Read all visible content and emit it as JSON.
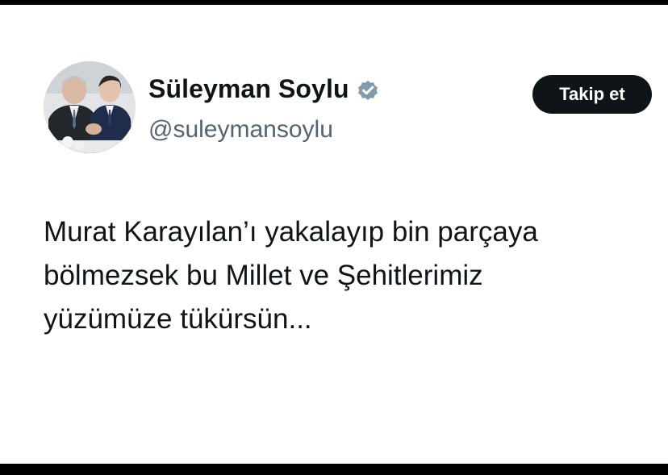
{
  "tweet": {
    "author": {
      "display_name": "Süleyman Soylu",
      "handle": "@suleymansoylu",
      "verified_icon": "verified-badge-icon",
      "avatar": "avatar-photo"
    },
    "follow_label": "Takip et",
    "text_lines": [
      "Murat Karayılan’ı yakalayıp bin parçaya",
      "bölmezsek bu Millet ve Şehitlerimiz",
      "yüzümüze tükürsün..."
    ]
  },
  "colors": {
    "background": "#000000",
    "card": "#ffffff",
    "text": "#0f1419",
    "secondary_text": "#536471",
    "verified": "#829aab",
    "button": "#0f1419"
  }
}
